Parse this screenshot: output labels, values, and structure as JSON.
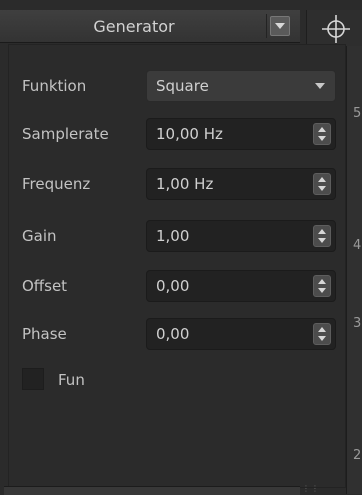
{
  "header": {
    "title": "Generator",
    "menu_icon": "chevron-down-icon",
    "target_icon": "crosshair-icon"
  },
  "axis_ticks": [
    "5",
    "4",
    "3",
    "2"
  ],
  "fields": {
    "funktion": {
      "label": "Funktion",
      "value": "Square"
    },
    "samplerate": {
      "label": "Samplerate",
      "value": "10,00 Hz"
    },
    "frequenz": {
      "label": "Frequenz",
      "value": "1,00 Hz"
    },
    "gain": {
      "label": "Gain",
      "value": "1,00"
    },
    "offset": {
      "label": "Offset",
      "value": "0,00"
    },
    "phase": {
      "label": "Phase",
      "value": "0,00"
    }
  },
  "fun_checkbox": {
    "label": "Fun",
    "checked": false
  },
  "colors": {
    "panel_bg": "#2b2b2b",
    "field_bg": "#222222",
    "header_bg": "#3a3a3a",
    "text": "#c9c9c9"
  }
}
